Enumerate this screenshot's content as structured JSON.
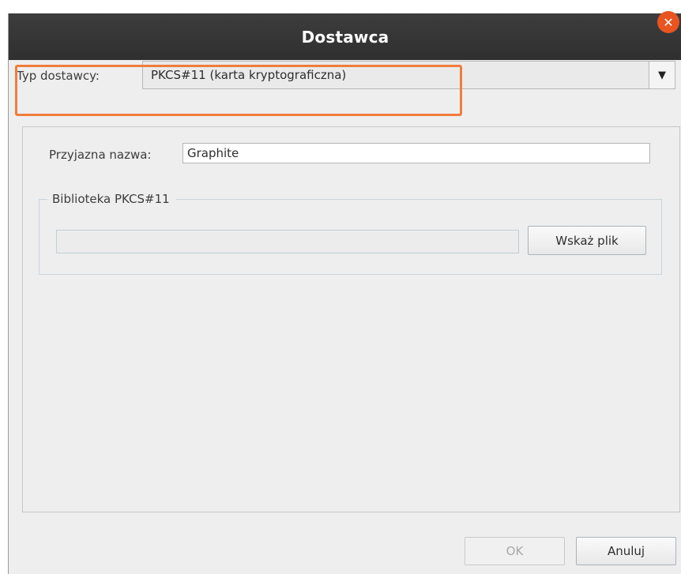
{
  "window": {
    "title": "Dostawca",
    "close_symbol": "✕"
  },
  "provider": {
    "label": "Typ dostawcy:",
    "selected": "PKCS#11 (karta kryptograficzna)",
    "dropdown_icon": "chevron-down-icon"
  },
  "form": {
    "friendly_name_label": "Przyjazna nazwa:",
    "friendly_name_value": "Graphite",
    "library_group_title": "Biblioteka PKCS#11",
    "library_path_value": "",
    "browse_button": "Wskaż plik"
  },
  "buttons": {
    "ok": "OK",
    "cancel": "Anuluj"
  },
  "colors": {
    "highlight": "#f07d3c",
    "close_button": "#e95420",
    "titlebar": "#333333"
  }
}
